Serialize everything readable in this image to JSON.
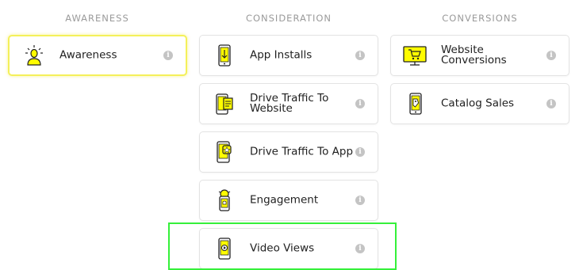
{
  "columns": {
    "awareness": {
      "heading": "AWARENESS"
    },
    "consideration": {
      "heading": "CONSIDERATION"
    },
    "conversions": {
      "heading": "CONVERSIONS"
    }
  },
  "cards": {
    "awareness": {
      "label": "Awareness",
      "icon": "lightbulb-person-icon"
    },
    "app_installs": {
      "label": "App Installs",
      "icon": "phone-download-icon"
    },
    "drive_traffic_website": {
      "label_line1": "Drive Traffic To",
      "label_line2": "Website",
      "icon": "phone-webpage-icon"
    },
    "drive_traffic_app": {
      "label": "Drive Traffic To App",
      "icon": "phone-app-icon"
    },
    "engagement": {
      "label": "Engagement",
      "icon": "phone-ring-icon"
    },
    "video_views": {
      "label": "Video Views",
      "icon": "phone-play-icon"
    },
    "website_conversions": {
      "label_line1": "Website",
      "label_line2": "Conversions",
      "icon": "monitor-cart-icon"
    },
    "catalog_sales": {
      "label": "Catalog Sales",
      "icon": "phone-tag-icon"
    }
  },
  "info_glyph": "i",
  "colors": {
    "accent_yellow": "#FFFC00",
    "selected_border": "#F4F05A",
    "highlight_green": "#35F03A",
    "info_grey": "#C4C4C4"
  }
}
